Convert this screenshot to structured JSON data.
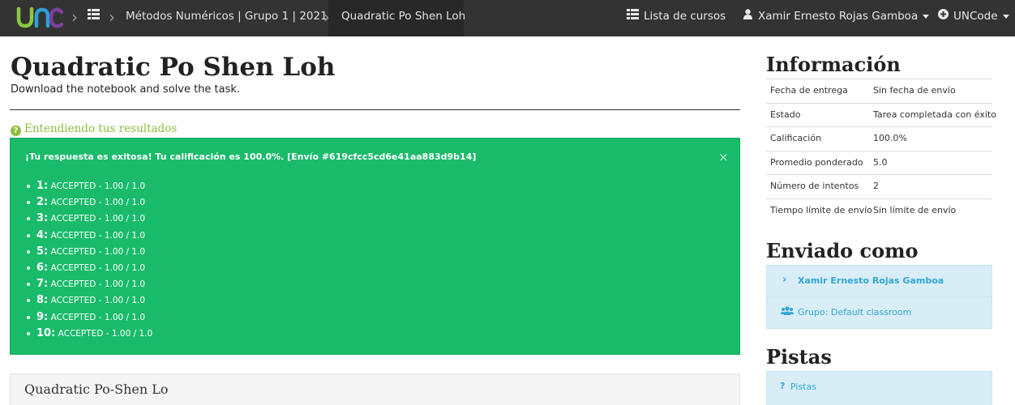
{
  "navbar": {
    "course_breadcrumb": "Métodos Numéricos | Grupo 1 | 2021...",
    "task_breadcrumb": "Quadratic Po Shen Loh",
    "courses_link": "Lista de cursos",
    "user_name": "Xamir Ernesto Rojas Gamboa",
    "platform_menu": "UNCode",
    "icons": [
      "unc-logo",
      "list-icon",
      "user-icon",
      "plus-circle-icon"
    ]
  },
  "task": {
    "title": "Quadratic Po Shen Loh",
    "subtitle": "Download the notebook and solve the task.",
    "help_link": "Entendiendo tus resultados"
  },
  "result": {
    "message": "¡Tu respuesta es exitosa! Tu calificación es 100.0%. [Envío #619cfcc5cd6e41aa883d9b14]",
    "close": "×",
    "tests": [
      {
        "num": "1:",
        "status": "ACCEPTED - 1.00 / 1.0"
      },
      {
        "num": "2:",
        "status": "ACCEPTED - 1.00 / 1.0"
      },
      {
        "num": "3:",
        "status": "ACCEPTED - 1.00 / 1.0"
      },
      {
        "num": "4:",
        "status": "ACCEPTED - 1.00 / 1.0"
      },
      {
        "num": "5:",
        "status": "ACCEPTED - 1.00 / 1.0"
      },
      {
        "num": "6:",
        "status": "ACCEPTED - 1.00 / 1.0"
      },
      {
        "num": "7:",
        "status": "ACCEPTED - 1.00 / 1.0"
      },
      {
        "num": "8:",
        "status": "ACCEPTED - 1.00 / 1.0"
      },
      {
        "num": "9:",
        "status": "ACCEPTED - 1.00 / 1.0"
      },
      {
        "num": "10:",
        "status": "ACCEPTED - 1.00 / 1.0"
      }
    ]
  },
  "content_panel": {
    "title": "Quadratic Po-Shen Lo"
  },
  "sidebar": {
    "info_heading": "Información",
    "info_rows": [
      {
        "label": "Fecha de entrega",
        "value": "Sin fecha de envío"
      },
      {
        "label": "Estado",
        "value": "Tarea completada con éxito"
      },
      {
        "label": "Calificación",
        "value": "100.0%"
      },
      {
        "label": "Promedio ponderado",
        "value": "5.0"
      },
      {
        "label": "Número de intentos",
        "value": "2"
      },
      {
        "label": "Tiempo límite de envío",
        "value": "Sin límite de envío"
      }
    ],
    "submitted_heading": "Enviado como",
    "submitted_user": "Xamir Ernesto Rojas Gamboa",
    "submitted_group": "Grupo: Default classroom",
    "hints_heading": "Pistas",
    "hints_link": "Pistas"
  },
  "colors": {
    "navbar_bg": "#333333",
    "success_green": "#19bb6a",
    "help_green": "#8cbd3f",
    "info_blue_bg": "#d9edf7",
    "info_blue_text": "#31a7d3"
  }
}
